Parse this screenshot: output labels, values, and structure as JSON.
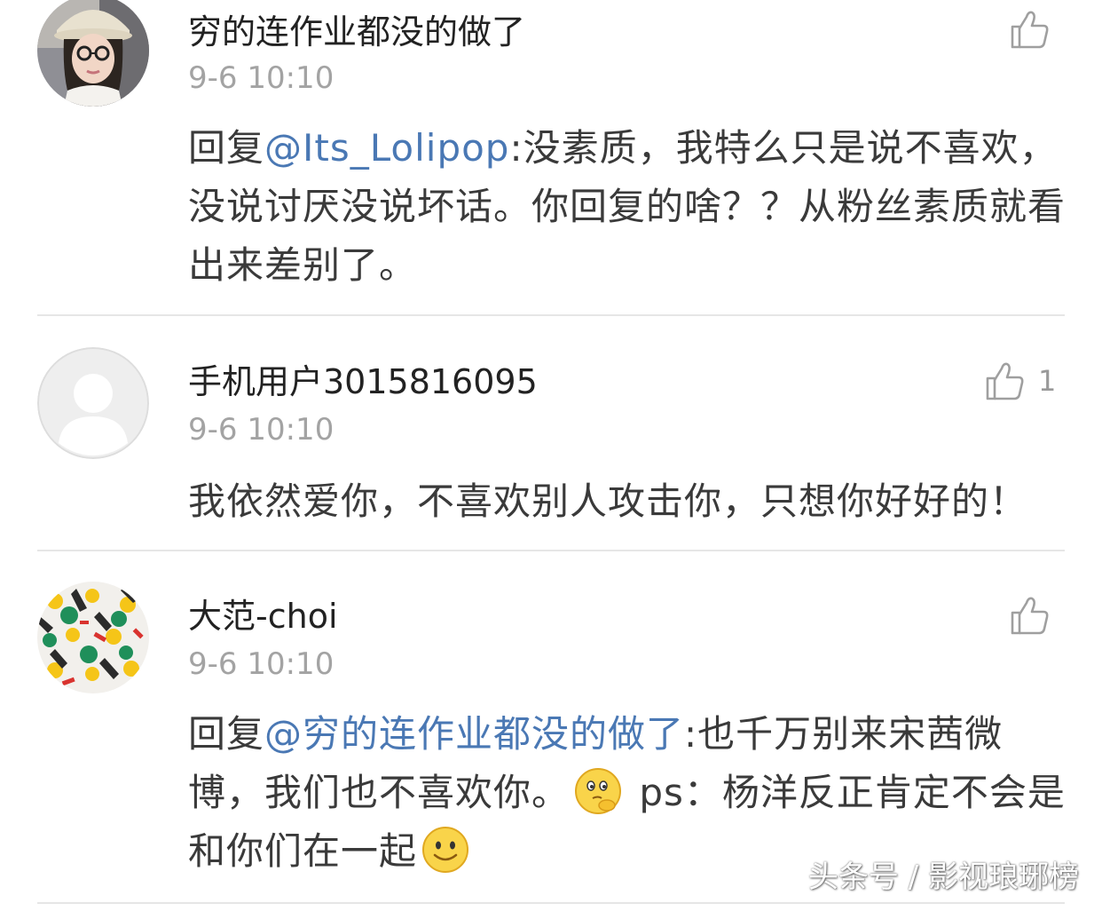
{
  "comments": [
    {
      "username": "穷的连作业都没的做了",
      "time": "9-6 10:10",
      "likes": "",
      "avatar_icon": "user-photo-avatar",
      "text": {
        "prefix": "回复",
        "mention": "@Its_Lolipop",
        "body": ":没素质，我特么只是说不喜欢，没说讨厌没说坏话。你回复的啥？？从粉丝素质就看出来差别了。"
      }
    },
    {
      "username": "手机用户3015816095",
      "time": "9-6 10:10",
      "likes": "1",
      "avatar_icon": "default-user-avatar",
      "text": {
        "body": "我依然爱你，不喜欢别人攻击你，只想你好好的！"
      }
    },
    {
      "username": "大范-choi",
      "time": "9-6 10:10",
      "likes": "",
      "avatar_icon": "pattern-avatar",
      "text": {
        "prefix": "回复",
        "mention": "@穷的连作业都没的做了",
        "body1": ":也千万别来宋茜微博，我们也不喜欢你。",
        "emoji1": "thinking-emoji",
        "body2": " ps：杨洋反正肯定不会是和你们在一起",
        "emoji2": "smile-emoji"
      }
    }
  ],
  "icons": {
    "like": "thumbs-up-icon"
  },
  "colors": {
    "mention": "#4a78b4",
    "timestamp": "#a3a3a3",
    "divider": "#e6e6e6"
  },
  "watermark": "头条号 / 影视琅琊榜"
}
